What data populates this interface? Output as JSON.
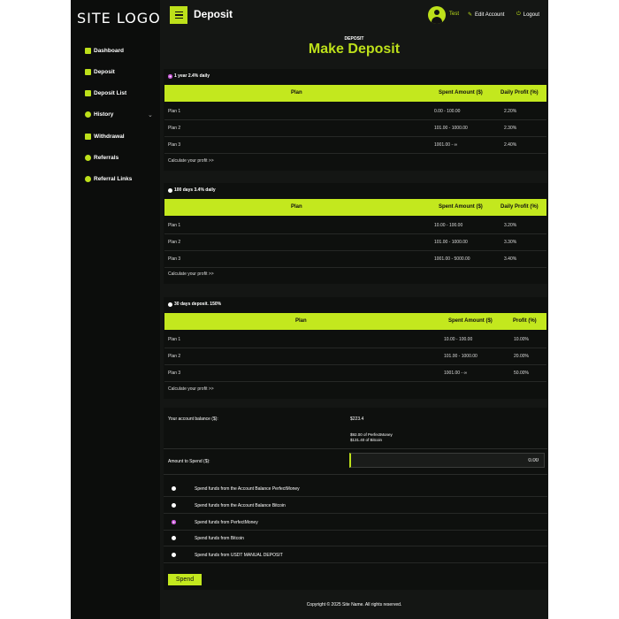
{
  "sidebar": {
    "logo": "SITE LOGO",
    "items": [
      {
        "label": "Dashboard",
        "icon": "dashboard-icon"
      },
      {
        "label": "Deposit",
        "icon": "deposit-icon"
      },
      {
        "label": "Deposit List",
        "icon": "deposit-list-icon"
      },
      {
        "label": "History",
        "icon": "history-icon"
      },
      {
        "label": "Withdrawal",
        "icon": "withdrawal-icon"
      },
      {
        "label": "Referrals",
        "icon": "share-icon"
      },
      {
        "label": "Referral Links",
        "icon": "link-icon"
      }
    ]
  },
  "header": {
    "title": "Deposit",
    "user": "Test",
    "edit_account": "Edit Account",
    "logout": "Logout"
  },
  "page": {
    "subtitle": "DEPOSIT",
    "title": "Make Deposit"
  },
  "plans": [
    {
      "name": "1 year 2.4% daily",
      "selected": true,
      "col_plan": "Plan",
      "col_amount": "Spent Amount ($)",
      "col_profit": "Daily Profit (%)",
      "rows": [
        {
          "plan": "Plan 1",
          "amount": "0.00 - 100.00",
          "profit": "2.20%"
        },
        {
          "plan": "Plan 2",
          "amount": "101.00 - 1000.00",
          "profit": "2.30%"
        },
        {
          "plan": "Plan 3",
          "amount": "1001.00 - ∞",
          "profit": "2.40%"
        }
      ],
      "calc": "Calculate your profit >>"
    },
    {
      "name": "100 days 3.4% daily",
      "selected": false,
      "col_plan": "Plan",
      "col_amount": "Spent Amount ($)",
      "col_profit": "Daily Profit (%)",
      "rows": [
        {
          "plan": "Plan 1",
          "amount": "10.00 - 100.00",
          "profit": "3.20%"
        },
        {
          "plan": "Plan 2",
          "amount": "101.00 - 1000.00",
          "profit": "3.30%"
        },
        {
          "plan": "Plan 3",
          "amount": "1001.00 - 5000.00",
          "profit": "3.40%"
        }
      ],
      "calc": "Calculate your profit >>"
    },
    {
      "name": "30 days deposit. 150%",
      "selected": false,
      "col_plan": "Plan",
      "col_amount": "Spent Amount ($)",
      "col_profit": "Profit (%)",
      "rows": [
        {
          "plan": "Plan 1",
          "amount": "10.00 - 100.00",
          "profit": "10.00%"
        },
        {
          "plan": "Plan 2",
          "amount": "101.00 - 1000.00",
          "profit": "20.00%"
        },
        {
          "plan": "Plan 3",
          "amount": "1001.00 - ∞",
          "profit": "50.00%"
        }
      ],
      "calc": "Calculate your profit >>"
    }
  ],
  "balance": {
    "label": "Your account balance ($):",
    "value": "$223.4",
    "detail_1": "$92.00 of PerfectMoney",
    "detail_2": "$131.40 of Bitcoin",
    "amount_label": "Amount to Spend ($):",
    "amount_value": "0.00"
  },
  "sources": [
    {
      "label": "Spend funds from the Account Balance PerfectMoney",
      "selected": false
    },
    {
      "label": "Spend funds from the Account Balance Bitcoin",
      "selected": false
    },
    {
      "label": "Spend funds from PerfectMoney",
      "selected": true
    },
    {
      "label": "Spend funds from Bitcoin",
      "selected": false
    },
    {
      "label": "Spend funds from USDT MANUAL DEPOSIT",
      "selected": false
    }
  ],
  "spend_button": "Spend",
  "footer": "Copyright © 2025 Site Name. All rights reserved.",
  "colors": {
    "accent": "#c3e81e",
    "background": "#141614",
    "sidebar": "#0c0d0c"
  }
}
